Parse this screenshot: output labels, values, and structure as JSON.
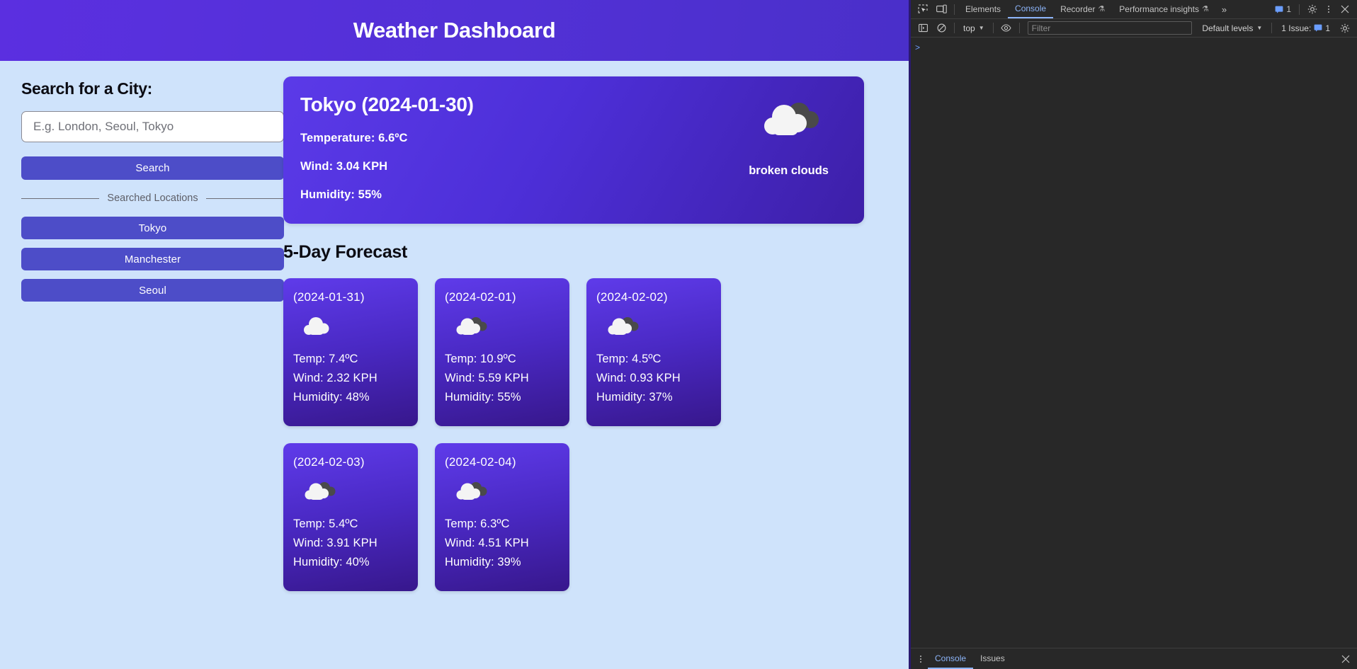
{
  "app": {
    "title": "Weather Dashboard"
  },
  "sidebar": {
    "heading": "Search for a City:",
    "search_placeholder": "E.g. London, Seoul, Tokyo",
    "search_value": "",
    "search_button": "Search",
    "divider_label": "Searched Locations",
    "cities": [
      "Tokyo",
      "Manchester",
      "Seoul"
    ]
  },
  "current": {
    "city_line": "Tokyo (2024-01-30)",
    "temperature": "Temperature: 6.6ºC",
    "wind": "Wind: 3.04 KPH",
    "humidity": "Humidity: 55%",
    "icon": "broken-clouds-icon",
    "description": "broken clouds"
  },
  "forecast": {
    "title": "5-Day Forecast",
    "days": [
      {
        "date": "(2024-01-31)",
        "icon": "cloud-icon",
        "temp": "Temp: 7.4ºC",
        "wind": "Wind: 2.32 KPH",
        "humidity": "Humidity: 48%"
      },
      {
        "date": "(2024-02-01)",
        "icon": "broken-clouds-icon",
        "temp": "Temp: 10.9ºC",
        "wind": "Wind: 5.59 KPH",
        "humidity": "Humidity: 55%"
      },
      {
        "date": "(2024-02-02)",
        "icon": "broken-clouds-icon",
        "temp": "Temp: 4.5ºC",
        "wind": "Wind: 0.93 KPH",
        "humidity": "Humidity: 37%"
      },
      {
        "date": "(2024-02-03)",
        "icon": "broken-clouds-icon",
        "temp": "Temp: 5.4ºC",
        "wind": "Wind: 3.91 KPH",
        "humidity": "Humidity: 40%"
      },
      {
        "date": "(2024-02-04)",
        "icon": "broken-clouds-icon",
        "temp": "Temp: 6.3ºC",
        "wind": "Wind: 4.51 KPH",
        "humidity": "Humidity: 39%"
      }
    ]
  },
  "devtools": {
    "tabs": [
      {
        "label": "Elements",
        "active": false,
        "flask": false
      },
      {
        "label": "Console",
        "active": true,
        "flask": false
      },
      {
        "label": "Recorder",
        "active": false,
        "flask": true
      },
      {
        "label": "Performance insights",
        "active": false,
        "flask": true
      }
    ],
    "more_tabs": "»",
    "message_count": "1",
    "console_toolbar": {
      "context": "top",
      "filter_placeholder": "Filter",
      "filter_value": "",
      "levels": "Default levels",
      "issues_text": "1 Issue:",
      "issues_count": "1"
    },
    "prompt": ">",
    "drawer_tabs": [
      {
        "label": "Console",
        "active": true
      },
      {
        "label": "Issues",
        "active": false
      }
    ]
  },
  "colors": {
    "brand_purple": "#4d4dc8",
    "header_gradient_start": "#5b2fe0",
    "page_background": "#cfe3fb",
    "card_gradient_start": "#5b3ae8",
    "card_gradient_end": "#3d1fa8",
    "devtools_background": "#282828",
    "devtools_accent": "#8cb4f8"
  }
}
